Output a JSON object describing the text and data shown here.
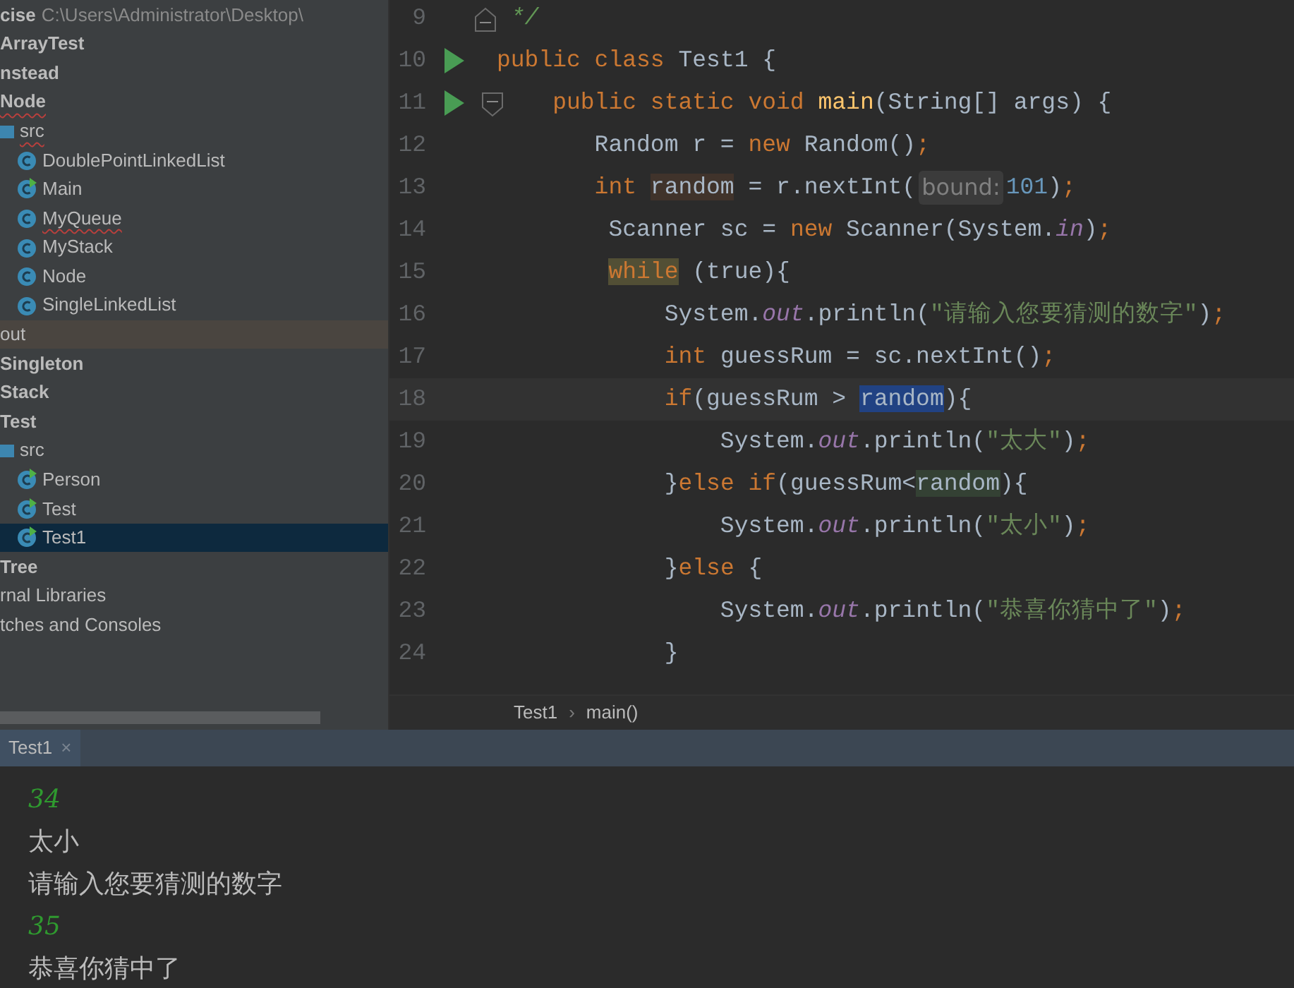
{
  "project_tree": [
    {
      "label": "cise",
      "path": "C:\\Users\\Administrator\\Desktop\\",
      "kind": "module",
      "selected": false
    },
    {
      "label": "ArrayTest",
      "kind": "module",
      "selected": false
    },
    {
      "label": "nstead",
      "kind": "module",
      "selected": false
    },
    {
      "label": "Node",
      "kind": "module",
      "error": true,
      "selected": false,
      "children": [
        {
          "label": "src",
          "kind": "folder",
          "error": true,
          "selected": false,
          "children": [
            {
              "label": "DoublePointLinkedList",
              "kind": "class",
              "selected": false
            },
            {
              "label": "Main",
              "kind": "class",
              "runnable": true,
              "selected": false
            },
            {
              "label": "MyQueue",
              "kind": "class",
              "error": true,
              "selected": false
            },
            {
              "label": "MyStack",
              "kind": "class",
              "selected": false
            },
            {
              "label": "Node",
              "kind": "class",
              "selected": false
            },
            {
              "label": "SingleLinkedList",
              "kind": "class",
              "selected": false
            }
          ]
        }
      ]
    },
    {
      "label": "out",
      "kind": "excluded",
      "selected": false
    },
    {
      "label": "Singleton",
      "kind": "module",
      "selected": false
    },
    {
      "label": "Stack",
      "kind": "module",
      "selected": false
    },
    {
      "label": "Test",
      "kind": "module",
      "selected": false,
      "children": [
        {
          "label": "src",
          "kind": "folder",
          "selected": false,
          "children": [
            {
              "label": "Person",
              "kind": "class",
              "runnable": true,
              "selected": false
            },
            {
              "label": "Test",
              "kind": "class",
              "runnable": true,
              "selected": false
            },
            {
              "label": "Test1",
              "kind": "class",
              "runnable": true,
              "selected": true
            }
          ]
        }
      ]
    },
    {
      "label": "Tree",
      "kind": "module",
      "selected": false
    },
    {
      "label": "rnal Libraries",
      "kind": "other",
      "selected": false
    },
    {
      "label": "tches and Consoles",
      "kind": "other",
      "selected": false
    }
  ],
  "editor": {
    "lines": [
      {
        "number": "9",
        "fold_end": true,
        "tokens": [
          {
            "t": " */",
            "kind": "comment"
          }
        ]
      },
      {
        "number": "10",
        "run": true,
        "tokens": [
          {
            "t": "public class ",
            "kind": "kw"
          },
          {
            "t": "Test1 {",
            "kind": "plain"
          }
        ]
      },
      {
        "number": "11",
        "run": true,
        "fold_start": true,
        "tokens": [
          {
            "t": "    public static void ",
            "kind": "kw"
          },
          {
            "t": "main",
            "kind": "method"
          },
          {
            "t": "(String[] args) {",
            "kind": "plain"
          }
        ]
      },
      {
        "number": "12",
        "tokens": [
          {
            "t": "       Random r = ",
            "kind": "plain"
          },
          {
            "t": "new ",
            "kind": "kw"
          },
          {
            "t": "Random()",
            "kind": "plain"
          },
          {
            "t": ";",
            "kind": "kw"
          }
        ]
      },
      {
        "number": "13",
        "tokens": [
          {
            "t": "       int ",
            "kind": "kw"
          },
          {
            "t": "random",
            "kind": "plain",
            "write_usage": true
          },
          {
            "t": " = r.nextInt(",
            "kind": "plain"
          },
          {
            "t": "bound:",
            "kind": "hint"
          },
          {
            "t": "101",
            "kind": "num"
          },
          {
            "t": ")",
            "kind": "plain"
          },
          {
            "t": ";",
            "kind": "kw"
          }
        ]
      },
      {
        "number": "14",
        "tokens": [
          {
            "t": "        Scanner sc = ",
            "kind": "plain"
          },
          {
            "t": "new ",
            "kind": "kw"
          },
          {
            "t": "Scanner(System.",
            "kind": "plain"
          },
          {
            "t": "in",
            "kind": "field"
          },
          {
            "t": ")",
            "kind": "plain"
          },
          {
            "t": ";",
            "kind": "kw"
          }
        ]
      },
      {
        "number": "15",
        "tokens": [
          {
            "t": "        while",
            "kind": "kw",
            "search_match": true
          },
          {
            "t": " (true){",
            "kind": "plain"
          }
        ]
      },
      {
        "number": "16",
        "tokens": [
          {
            "t": "            System.",
            "kind": "plain"
          },
          {
            "t": "out",
            "kind": "field"
          },
          {
            "t": ".println(",
            "kind": "plain"
          },
          {
            "t": "\"请输入您要猜测的数字\"",
            "kind": "str"
          },
          {
            "t": ")",
            "kind": "plain"
          },
          {
            "t": ";",
            "kind": "kw"
          }
        ]
      },
      {
        "number": "17",
        "tokens": [
          {
            "t": "            int ",
            "kind": "kw"
          },
          {
            "t": "guessRum = sc.nextInt()",
            "kind": "plain"
          },
          {
            "t": ";",
            "kind": "kw"
          }
        ]
      },
      {
        "number": "18",
        "current": true,
        "tokens": [
          {
            "t": "            if",
            "kind": "kw"
          },
          {
            "t": "(guessRum > ",
            "kind": "plain"
          },
          {
            "t": "random",
            "kind": "plain",
            "selected_text": true
          },
          {
            "t": "){",
            "kind": "plain"
          }
        ]
      },
      {
        "number": "19",
        "tokens": [
          {
            "t": "                System.",
            "kind": "plain"
          },
          {
            "t": "out",
            "kind": "field"
          },
          {
            "t": ".println(",
            "kind": "plain"
          },
          {
            "t": "\"太大\"",
            "kind": "str"
          },
          {
            "t": ")",
            "kind": "plain"
          },
          {
            "t": ";",
            "kind": "kw"
          }
        ]
      },
      {
        "number": "20",
        "tokens": [
          {
            "t": "            }",
            "kind": "plain"
          },
          {
            "t": "else if",
            "kind": "kw"
          },
          {
            "t": "(guessRum<",
            "kind": "plain"
          },
          {
            "t": "random",
            "kind": "plain",
            "read_usage": true
          },
          {
            "t": "){",
            "kind": "plain"
          }
        ]
      },
      {
        "number": "21",
        "tokens": [
          {
            "t": "                System.",
            "kind": "plain"
          },
          {
            "t": "out",
            "kind": "field"
          },
          {
            "t": ".println(",
            "kind": "plain"
          },
          {
            "t": "\"太小\"",
            "kind": "str"
          },
          {
            "t": ")",
            "kind": "plain"
          },
          {
            "t": ";",
            "kind": "kw"
          }
        ]
      },
      {
        "number": "22",
        "tokens": [
          {
            "t": "            }",
            "kind": "plain"
          },
          {
            "t": "else ",
            "kind": "kw"
          },
          {
            "t": "{",
            "kind": "plain"
          }
        ]
      },
      {
        "number": "23",
        "tokens": [
          {
            "t": "                System.",
            "kind": "plain"
          },
          {
            "t": "out",
            "kind": "field"
          },
          {
            "t": ".println(",
            "kind": "plain"
          },
          {
            "t": "\"恭喜你猜中了\"",
            "kind": "str"
          },
          {
            "t": ")",
            "kind": "plain"
          },
          {
            "t": ";",
            "kind": "kw"
          }
        ]
      },
      {
        "number": "24",
        "tokens": [
          {
            "t": "            }",
            "kind": "plain"
          }
        ]
      }
    ]
  },
  "breadcrumbs": [
    "Test1",
    "main()"
  ],
  "breadcrumb_separator": "›",
  "run_tabs": [
    {
      "label": "Test1",
      "close": "×",
      "selected": true
    }
  ],
  "console": [
    {
      "text": "34",
      "kind": "input"
    },
    {
      "text": "太小",
      "kind": "output"
    },
    {
      "text": "请输入您要猜测的数字",
      "kind": "output"
    },
    {
      "text": "35",
      "kind": "input"
    },
    {
      "text": "恭喜你猜中了",
      "kind": "output"
    }
  ]
}
